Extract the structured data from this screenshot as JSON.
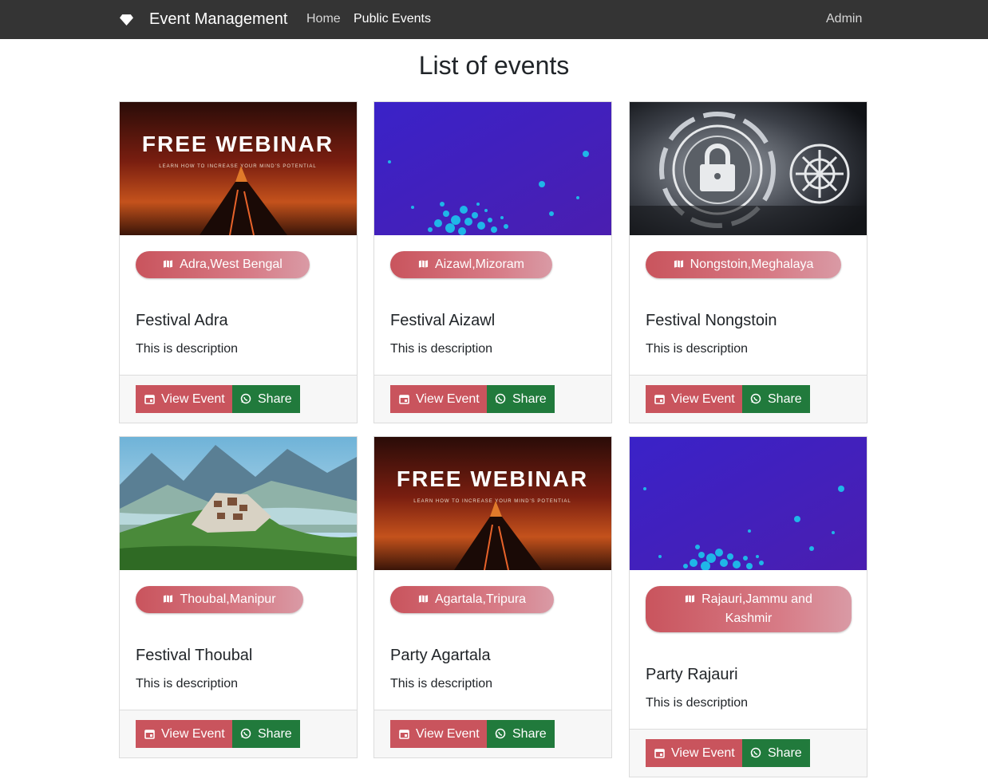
{
  "navbar": {
    "brand": "Event Management",
    "brand_icon": "diamond-icon",
    "links": [
      "Home",
      "Public Events"
    ],
    "right": "Admin"
  },
  "page": {
    "title": "List of events"
  },
  "colors": {
    "accent": "#c9545d",
    "share": "#217a3c",
    "navbar": "#343434"
  },
  "events": [
    {
      "location": "Adra,West Bengal",
      "title": "Festival Adra",
      "description": "This is description",
      "view_label": "View Event",
      "share_label": "Share",
      "image": "free-webinar-volcano"
    },
    {
      "location": "Aizawl,Mizoram",
      "title": "Festival Aizawl",
      "description": "This is description",
      "view_label": "View Event",
      "share_label": "Share",
      "image": "purple-dots"
    },
    {
      "location": "Nongstoin,Meghalaya",
      "title": "Festival Nongstoin",
      "description": "This is description",
      "view_label": "View Event",
      "share_label": "Share",
      "image": "security-lock"
    },
    {
      "location": "Thoubal,Manipur",
      "title": "Festival Thoubal",
      "description": "This is description",
      "view_label": "View Event",
      "share_label": "Share",
      "image": "mountain-monastery"
    },
    {
      "location": "Agartala,Tripura",
      "title": "Party Agartala",
      "description": "This is description",
      "view_label": "View Event",
      "share_label": "Share",
      "image": "free-webinar-volcano"
    },
    {
      "location": "Rajauri,Jammu and Kashmir",
      "title": "Party Rajauri",
      "description": "This is description",
      "view_label": "View Event",
      "share_label": "Share",
      "image": "purple-dots"
    }
  ],
  "webinar": {
    "heading": "FREE WEBINAR",
    "subheading": "LEARN HOW TO INCREASE YOUR MIND'S POTENTIAL"
  }
}
